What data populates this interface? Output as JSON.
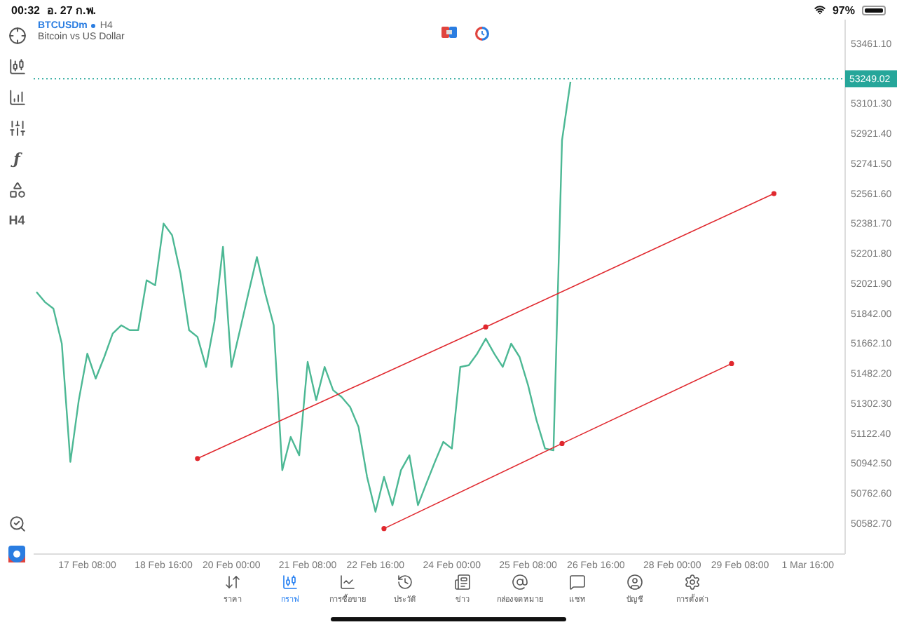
{
  "status_bar": {
    "time": "00:32",
    "date": "อ. 27 ก.พ.",
    "battery": "97%"
  },
  "chart_header": {
    "symbol": "BTCUSDm",
    "timeframe": "H4",
    "description": "Bitcoin vs US Dollar"
  },
  "left_toolbar": [
    {
      "kind": "icon"
    },
    {
      "kind": "icon"
    },
    {
      "kind": "icon"
    },
    {
      "kind": "icon"
    },
    {
      "kind": "glyph",
      "label": "ƒ"
    },
    {
      "kind": "icon"
    },
    {
      "kind": "glyph",
      "label": "H4"
    }
  ],
  "chart": {
    "chart_data": {
      "type": "line",
      "ylim": [
        50397,
        53604
      ],
      "categories": [
        null,
        null,
        null,
        null,
        null,
        null,
        "17 Feb 08:00",
        null,
        null,
        null,
        null,
        null,
        null,
        null,
        null,
        "18 Feb 16:00",
        null,
        null,
        null,
        null,
        null,
        null,
        null,
        "20 Feb 00:00",
        null,
        null,
        null,
        null,
        null,
        null,
        null,
        null,
        "21 Feb 08:00",
        null,
        null,
        null,
        null,
        null,
        null,
        null,
        "22 Feb 16:00",
        null,
        null,
        null,
        null,
        null,
        null,
        null,
        null,
        "24 Feb 00:00",
        null,
        null,
        null,
        null,
        null,
        null,
        null,
        null,
        "25 Feb 08:00",
        null,
        null,
        null,
        null,
        null,
        null,
        null,
        "26 Feb 16:00",
        null,
        null,
        null,
        null,
        null,
        null,
        null,
        null,
        "28 Feb 00:00",
        null,
        null,
        null,
        null,
        null,
        null,
        null,
        "29 Feb 08:00",
        null,
        null,
        null,
        null,
        null,
        null,
        null,
        "1 Mar 16:00",
        null,
        null,
        null,
        null
      ],
      "series": [
        {
          "color": "#4cb894",
          "values": [
            51970,
            51910,
            51870,
            51660,
            50950,
            51320,
            51600,
            51450,
            51580,
            51720,
            51770,
            51740,
            51740,
            52040,
            52010,
            52380,
            52310,
            52080,
            51740,
            51700,
            51520,
            51790,
            52240,
            51520,
            51740,
            51960,
            52180,
            51960,
            51770,
            50900,
            51100,
            50990,
            51550,
            51320,
            51520,
            51380,
            51340,
            51280,
            51160,
            50860,
            50650,
            50860,
            50690,
            50900,
            50990,
            50690,
            50820,
            50950,
            51070,
            51030,
            51520,
            51530,
            51600,
            51690,
            51600,
            51520,
            51660,
            51580,
            51410,
            51200,
            51030,
            51020,
            52880,
            53230,
            null,
            null,
            null,
            null,
            null,
            null,
            null,
            null,
            null,
            null,
            null,
            null,
            null,
            null,
            null,
            null,
            null,
            null,
            null,
            null,
            null,
            null,
            null,
            null,
            null,
            null,
            null,
            null,
            null,
            null,
            null,
            null
          ]
        },
        {
          "color": "#e0282e",
          "marker": true,
          "values": [
            null,
            null,
            null,
            null,
            null,
            null,
            null,
            null,
            null,
            null,
            null,
            null,
            null,
            null,
            null,
            null,
            null,
            null,
            null,
            50970,
            null,
            null,
            null,
            null,
            null,
            null,
            null,
            null,
            null,
            null,
            null,
            null,
            null,
            null,
            null,
            null,
            null,
            null,
            null,
            null,
            null,
            null,
            null,
            null,
            null,
            null,
            null,
            null,
            null,
            null,
            null,
            null,
            null,
            51760,
            null,
            null,
            null,
            null,
            null,
            null,
            null,
            null,
            null,
            null,
            null,
            null,
            null,
            null,
            null,
            null,
            null,
            null,
            null,
            null,
            null,
            null,
            null,
            null,
            null,
            null,
            null,
            null,
            null,
            null,
            null,
            null,
            null,
            52560,
            null,
            null,
            null,
            null,
            null,
            null,
            null,
            null
          ]
        },
        {
          "color": "#e0282e",
          "marker": true,
          "values": [
            null,
            null,
            null,
            null,
            null,
            null,
            null,
            null,
            null,
            null,
            null,
            null,
            null,
            null,
            null,
            null,
            null,
            null,
            null,
            null,
            null,
            null,
            null,
            null,
            null,
            null,
            null,
            null,
            null,
            null,
            null,
            null,
            null,
            null,
            null,
            null,
            null,
            null,
            null,
            null,
            null,
            50550,
            null,
            null,
            null,
            null,
            null,
            null,
            null,
            null,
            null,
            null,
            null,
            null,
            null,
            null,
            null,
            null,
            null,
            null,
            null,
            null,
            51060,
            null,
            null,
            null,
            null,
            null,
            null,
            null,
            null,
            null,
            null,
            null,
            null,
            null,
            null,
            null,
            null,
            null,
            null,
            null,
            51540,
            null,
            null,
            null,
            null,
            null,
            null,
            null,
            null,
            null,
            null,
            null,
            null,
            null
          ]
        }
      ],
      "yticks": [
        {
          "value": 53461.1,
          "label": "53461.10"
        },
        {
          "value": 53101.3,
          "label": "53101.30"
        },
        {
          "value": 52921.4,
          "label": "52921.40"
        },
        {
          "value": 52741.5,
          "label": "52741.50"
        },
        {
          "value": 52561.6,
          "label": "52561.60"
        },
        {
          "value": 52381.7,
          "label": "52381.70"
        },
        {
          "value": 52201.8,
          "label": "52201.80"
        },
        {
          "value": 52021.9,
          "label": "52021.90"
        },
        {
          "value": 51842,
          "label": "51842.00"
        },
        {
          "value": 51662.1,
          "label": "51662.10"
        },
        {
          "value": 51482.2,
          "label": "51482.20"
        },
        {
          "value": 51302.3,
          "label": "51302.30"
        },
        {
          "value": 51122.4,
          "label": "51122.40"
        },
        {
          "value": 50942.5,
          "label": "50942.50"
        },
        {
          "value": 50762.6,
          "label": "50762.60"
        },
        {
          "value": 50582.7,
          "label": "50582.70"
        }
      ],
      "ref_lines": [
        {
          "axis": "y",
          "value": 53249.02,
          "label": "53249.02"
        }
      ]
    }
  },
  "tabs": [
    {
      "label": "ราคา",
      "selected": false
    },
    {
      "label": "กราฟ",
      "selected": true
    },
    {
      "label": "การซื้อขาย",
      "selected": false
    },
    {
      "label": "ประวัติ",
      "selected": false
    },
    {
      "label": "ข่าว",
      "selected": false
    },
    {
      "label": "กล่องจดหมาย",
      "selected": false
    },
    {
      "label": "แชท",
      "selected": false
    },
    {
      "label": "บัญชี",
      "selected": false
    },
    {
      "label": "การตั้งค่า",
      "selected": false
    }
  ]
}
